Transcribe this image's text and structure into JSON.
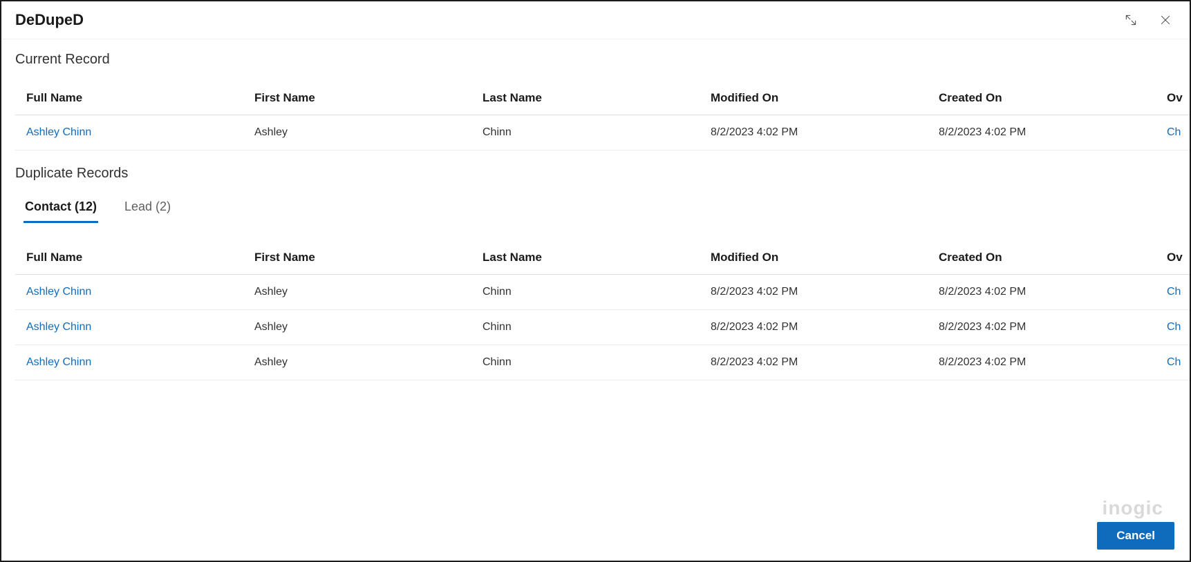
{
  "header": {
    "title": "DeDupeD"
  },
  "sections": {
    "current_record": "Current Record",
    "duplicate_records": "Duplicate Records"
  },
  "columns": {
    "full_name": "Full Name",
    "first_name": "First Name",
    "last_name": "Last Name",
    "modified_on": "Modified On",
    "created_on": "Created On",
    "owner_partial": "Ov"
  },
  "current": {
    "full_name": "Ashley Chinn",
    "first_name": "Ashley",
    "last_name": "Chinn",
    "modified_on": "8/2/2023 4:02 PM",
    "created_on": "8/2/2023 4:02 PM",
    "owner_partial": "Ch"
  },
  "tabs": {
    "contact": "Contact (12)",
    "lead": "Lead (2)"
  },
  "duplicates": [
    {
      "full_name": "Ashley Chinn",
      "first_name": "Ashley",
      "last_name": "Chinn",
      "modified_on": "8/2/2023 4:02 PM",
      "created_on": "8/2/2023 4:02 PM",
      "owner_partial": "Ch"
    },
    {
      "full_name": "Ashley Chinn",
      "first_name": "Ashley",
      "last_name": "Chinn",
      "modified_on": "8/2/2023 4:02 PM",
      "created_on": "8/2/2023 4:02 PM",
      "owner_partial": "Ch"
    },
    {
      "full_name": "Ashley Chinn",
      "first_name": "Ashley",
      "last_name": "Chinn",
      "modified_on": "8/2/2023 4:02 PM",
      "created_on": "8/2/2023 4:02 PM",
      "owner_partial": "Ch"
    }
  ],
  "footer": {
    "cancel": "Cancel"
  },
  "watermark": "inogic"
}
